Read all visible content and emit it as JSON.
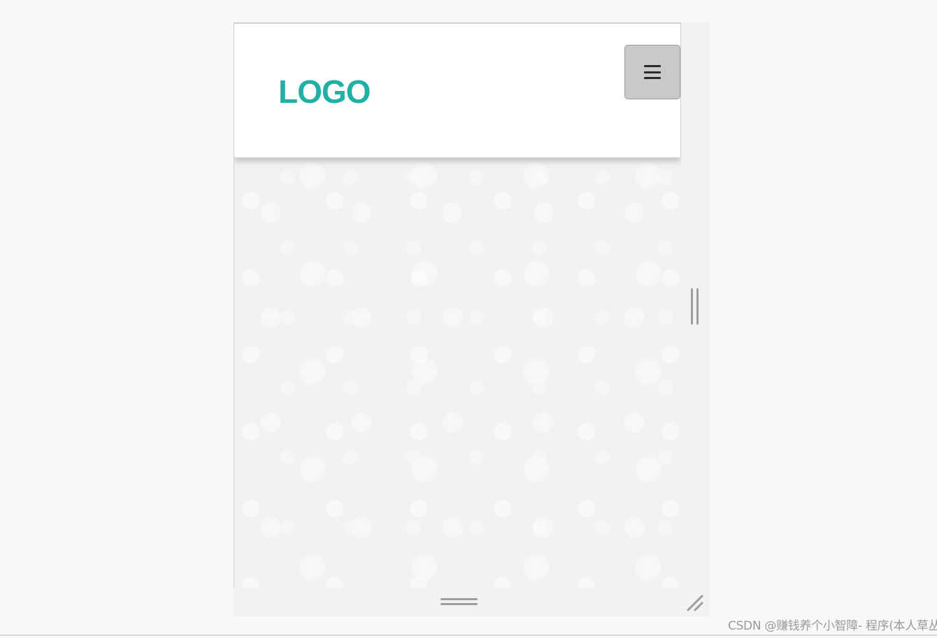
{
  "header": {
    "logo_text": "LOGO",
    "menu_button_icon": "hamburger-menu-icon"
  },
  "colors": {
    "logo": "#22b0a6",
    "page_background": "#f8f8f8",
    "header_background": "#ffffff",
    "menu_button_background": "#c8c9cb"
  },
  "resize_handles": {
    "right": "vertical-grip-icon",
    "bottom": "horizontal-grip-icon",
    "corner": "resize-corner-icon"
  },
  "watermark": {
    "text": "CSDN @赚钱养个小智障- 程序(本人草丛)"
  }
}
